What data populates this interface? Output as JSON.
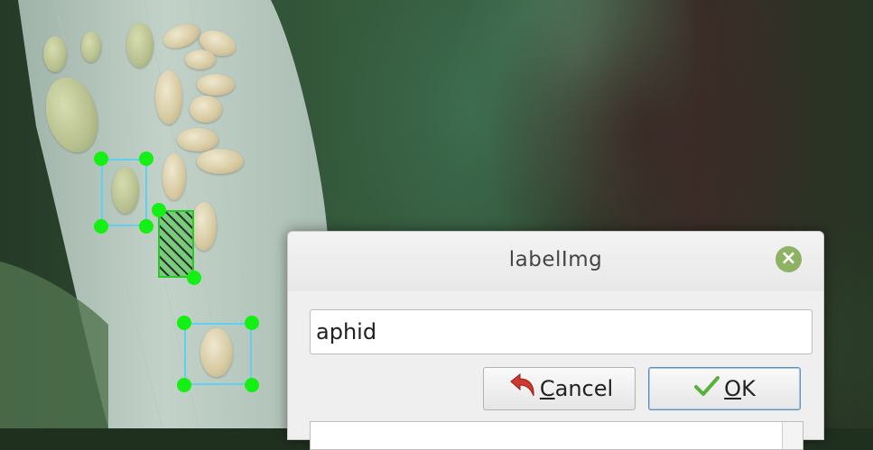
{
  "dialog": {
    "title": "labelImg",
    "input_value": "aphid",
    "cancel_label": "Cancel",
    "ok_label": "OK"
  },
  "icons": {
    "close": "close-icon",
    "cancel": "undo-arrow-icon",
    "ok": "checkmark-icon"
  },
  "colors": {
    "bbox_border": "#5fd0f0",
    "bbox_handle": "#14ef14",
    "active_bbox": "#25cc25",
    "close_button": "#8db264"
  }
}
